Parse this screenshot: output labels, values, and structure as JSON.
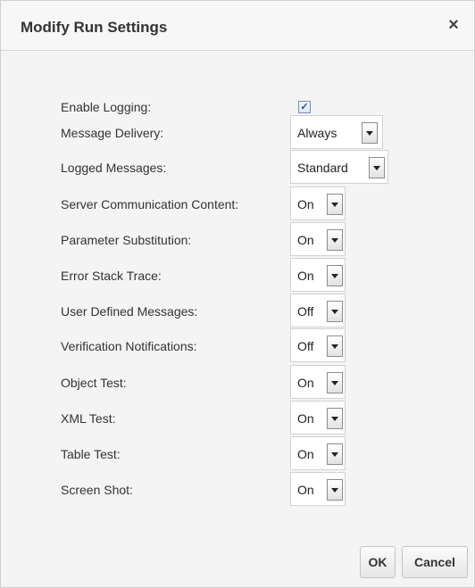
{
  "dialog": {
    "title": "Modify Run Settings",
    "close_label": "×"
  },
  "settings": {
    "enable_logging": {
      "label": "Enable Logging:",
      "checked": true,
      "check_glyph": "✓"
    },
    "message_delivery": {
      "label": "Message Delivery:",
      "value": "Always"
    },
    "logged_messages": {
      "label": "Logged Messages:",
      "value": "Standard"
    },
    "server_communication_content": {
      "label": "Server Communication Content:",
      "value": "On"
    },
    "parameter_substitution": {
      "label": "Parameter Substitution:",
      "value": "On"
    },
    "error_stack_trace": {
      "label": "Error Stack Trace:",
      "value": "On"
    },
    "user_defined_messages": {
      "label": "User Defined Messages:",
      "value": "Off"
    },
    "verification_notifications": {
      "label": "Verification Notifications:",
      "value": "Off"
    },
    "object_test": {
      "label": "Object Test:",
      "value": "On"
    },
    "xml_test": {
      "label": "XML Test:",
      "value": "On"
    },
    "table_test": {
      "label": "Table Test:",
      "value": "On"
    },
    "screen_shot": {
      "label": "Screen Shot:",
      "value": "On"
    }
  },
  "footer": {
    "ok_label": "OK",
    "cancel_label": "Cancel"
  }
}
